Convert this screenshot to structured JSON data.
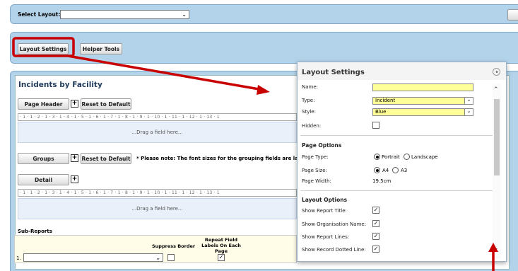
{
  "top_bar": {
    "select_layout_label": "Select Layout:",
    "select_layout_value": ""
  },
  "tools_bar": {
    "layout_settings_label": "Layout Settings",
    "helper_tools_label": "Helper Tools"
  },
  "report": {
    "title": "Incidents by Facility",
    "page_header_label": "Page Header",
    "reset_label": "Reset to Default",
    "ruler_text": "· 1 · 1 · 2 · 1 · 3 · 1 · 4 · 1 · 5 · 1 · 6 · 1 · 7 · 1 · 8 · 1 · 9 · 1 · 10 · 1 · 11 · 1 · 12 · 1 · 13 · 1",
    "drag_text": "...Drag a field here...",
    "groups_label": "Groups",
    "groups_note": "* Please note: The font sizes for the grouping fields are larger",
    "detail_label": "Detail",
    "subreports_title": "Sub-Reports",
    "suppress_border_label": "Suppress Border",
    "repeat_labels_label": "Repeat Field Labels On Each Page",
    "subreport_row_num": "1.",
    "repeat_checked": "✓"
  },
  "layout_panel": {
    "title": "Layout Settings",
    "collapse_glyph": "»",
    "name_label": "Name:",
    "name_value": "",
    "type_label": "Type:",
    "type_value": "Incident",
    "style_label": "Style:",
    "style_value": "Blue",
    "hidden_label": "Hidden:",
    "page_options_title": "Page Options",
    "page_type_label": "Page Type:",
    "portrait_label": "Portrait",
    "landscape_label": "Landscape",
    "page_size_label": "Page Size:",
    "a4_label": "A4",
    "a3_label": "A3",
    "page_width_label": "Page Width:",
    "page_width_value": "19.5cm",
    "layout_options_title": "Layout Options",
    "show_report_title_label": "Show Report Title:",
    "show_org_name_label": "Show Organisation Name:",
    "show_report_lines_label": "Show Report Lines:",
    "show_dotted_line_label": "Show Record Dotted Line:",
    "check_glyph": "✓"
  },
  "colors": {
    "annotation_red": "#c80000",
    "highlight_yellow": "#ffff99",
    "panel_blue": "#b3d3ea"
  }
}
